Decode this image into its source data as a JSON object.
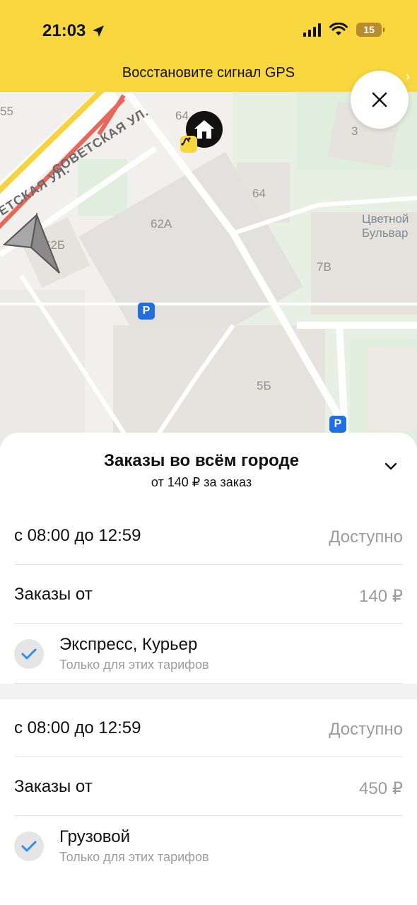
{
  "status_bar": {
    "time": "21:03",
    "battery": "15",
    "icons": [
      "location-arrow-icon",
      "signal-icon",
      "wifi-icon",
      "battery-icon"
    ]
  },
  "gps_banner": {
    "text": "Восстановите сигнал GPS"
  },
  "map": {
    "street": "СОВЕТСКАЯ УЛ.",
    "street_left": "ЕТСКАЯ УЛ.",
    "buildings": [
      "55",
      "64",
      "3",
      "64",
      "62А",
      "62Б",
      "7В",
      "5Б"
    ],
    "park_name_line1": "Цветной",
    "park_name_line2": "Бульвар",
    "parking_label": "P",
    "colors": {
      "park": "#dfeedd",
      "road": "#ffffff",
      "building": "#e4e1dd",
      "traffic_yellow": "#f6d33f",
      "traffic_red": "#e7675c"
    }
  },
  "sheet": {
    "title": "Заказы во всём городе",
    "subtitle": "от 140 ₽ за заказ",
    "groups": [
      {
        "time_range": "с 08:00 до 12:59",
        "status": "Доступно",
        "orders_label": "Заказы от",
        "orders_price": "140 ₽",
        "tariff_name": "Экспресс, Курьер",
        "tariff_note": "Только для этих тарифов"
      },
      {
        "time_range": "с 08:00 до 12:59",
        "status": "Доступно",
        "orders_label": "Заказы от",
        "orders_price": "450 ₽",
        "tariff_name": "Грузовой",
        "tariff_note": "Только для этих тарифов"
      }
    ]
  },
  "accent_colors": {
    "yellow": "#f8d73e",
    "check_blue": "#2f8ee6",
    "parking_blue": "#1f6fe0"
  }
}
